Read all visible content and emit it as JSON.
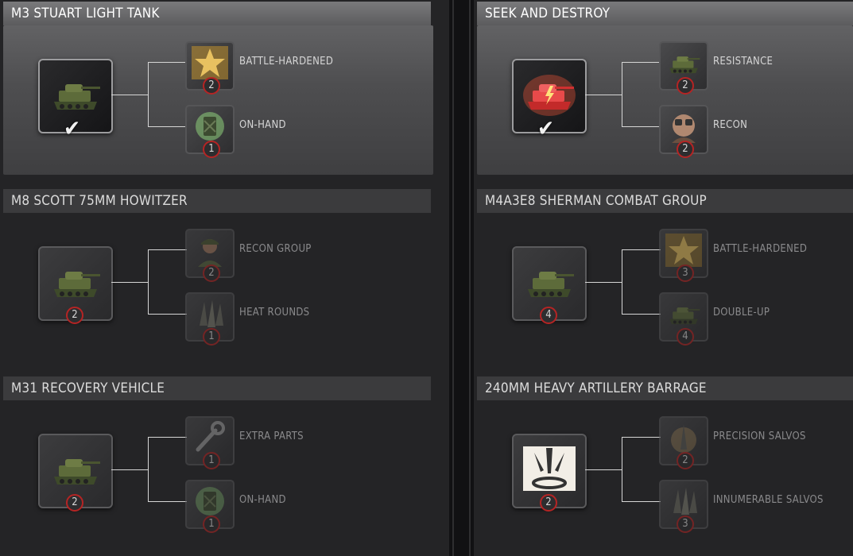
{
  "left_column": [
    {
      "title": "M3 STUART LIGHT TANK",
      "selected": true,
      "icon": "stuart-tank-icon",
      "count": "",
      "upgrades": [
        {
          "label": "BATTLE-HARDENED",
          "count": "2",
          "icon": "star-icon"
        },
        {
          "label": "ON-HAND",
          "count": "1",
          "icon": "jerrycan-icon"
        }
      ]
    },
    {
      "title": "M8 SCOTT 75MM HOWITZER",
      "selected": false,
      "icon": "scott-howitzer-icon",
      "count": "2",
      "upgrades": [
        {
          "label": "RECON GROUP",
          "count": "2",
          "icon": "soldier-icon"
        },
        {
          "label": "HEAT ROUNDS",
          "count": "1",
          "icon": "shells-icon"
        }
      ]
    },
    {
      "title": "M31 RECOVERY VEHICLE",
      "selected": false,
      "icon": "recovery-vehicle-icon",
      "count": "2",
      "upgrades": [
        {
          "label": "EXTRA PARTS",
          "count": "1",
          "icon": "wrench-icon"
        },
        {
          "label": "ON-HAND",
          "count": "1",
          "icon": "jerrycan-icon"
        }
      ]
    }
  ],
  "right_column": [
    {
      "title": "SEEK AND DESTROY",
      "selected": true,
      "icon": "red-tank-ability-icon",
      "count": "",
      "upgrades": [
        {
          "label": "RESISTANCE",
          "count": "2",
          "icon": "damaged-tank-icon"
        },
        {
          "label": "RECON",
          "count": "2",
          "icon": "binoculars-soldier-icon"
        }
      ]
    },
    {
      "title": "M4A3E8 SHERMAN COMBAT GROUP",
      "selected": false,
      "icon": "sherman-tank-icon",
      "count": "4",
      "upgrades": [
        {
          "label": "BATTLE-HARDENED",
          "count": "3",
          "icon": "star-icon"
        },
        {
          "label": "DOUBLE-UP",
          "count": "4",
          "icon": "tank-icon"
        }
      ]
    },
    {
      "title": "240MM HEAVY ARTILLERY BARRAGE",
      "selected": false,
      "icon": "artillery-barrage-icon",
      "count": "2",
      "upgrades": [
        {
          "label": "PRECISION SALVOS",
          "count": "2",
          "icon": "shell-icon"
        },
        {
          "label": "INNUMERABLE SALVOS",
          "count": "3",
          "icon": "shells-icon"
        }
      ]
    }
  ],
  "colors": {
    "badge_border": "#b52424",
    "selected_panel": "#5a5a5c",
    "ability_red": "#e23b3b",
    "star_gold": "#d9a53a"
  }
}
